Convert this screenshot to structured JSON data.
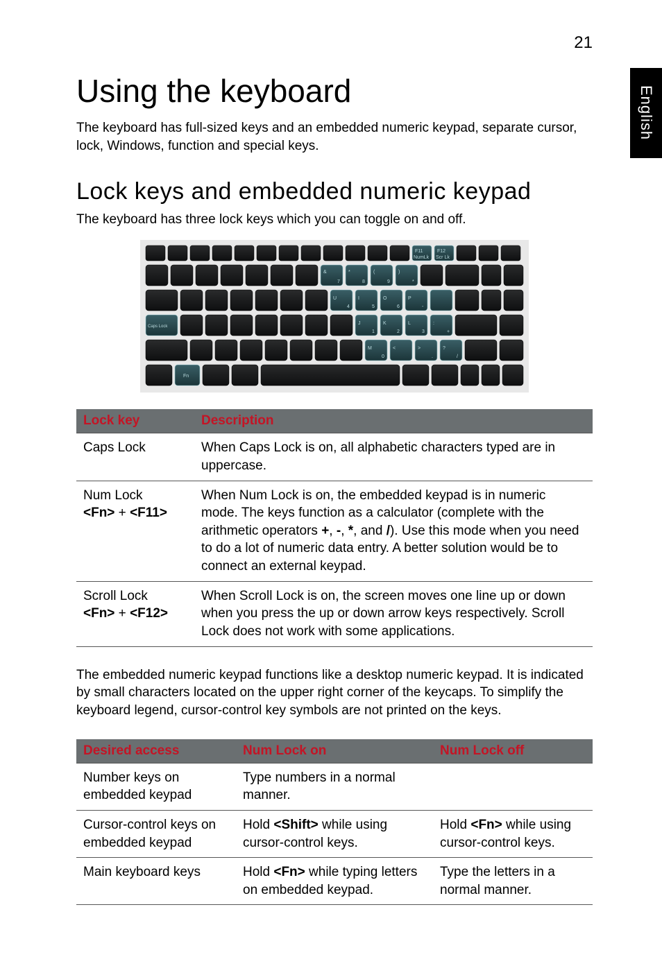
{
  "page_number": "21",
  "side_tab": "English",
  "h1": "Using the keyboard",
  "intro": "The keyboard has full-sized keys and an embedded numeric keypad, separate cursor, lock, Windows, function and special keys.",
  "h2": "Lock keys and embedded numeric keypad",
  "lead": "The keyboard has three lock keys which you can toggle on and off.",
  "table1": {
    "headers": [
      "Lock key",
      "Description"
    ],
    "rows": [
      {
        "key": "Caps Lock",
        "desc": "When Caps Lock is on, all alphabetic characters typed are in uppercase."
      },
      {
        "key_line1": "Num Lock",
        "key_line2_a": "<Fn>",
        "key_line2_plus": " + ",
        "key_line2_b": "<F11>",
        "desc_a": "When Num Lock is on, the embedded keypad is in numeric mode. The keys function as a calculator (complete with the arithmetic operators ",
        "desc_b": "+",
        "desc_c": ", ",
        "desc_d": "-",
        "desc_e": ", ",
        "desc_f": "*",
        "desc_g": ", and ",
        "desc_h": "/",
        "desc_i": "). Use this mode when you need to do a lot of numeric data entry. A better solution would be to connect an external keypad."
      },
      {
        "key_line1": "Scroll Lock",
        "key_line2_a": "<Fn>",
        "key_line2_plus": " + ",
        "key_line2_b": "<F12>",
        "desc": "When Scroll Lock is on, the screen moves one line up or down when you press the up or down arrow keys respectively. Scroll Lock does not work with some applications."
      }
    ]
  },
  "para2": "The embedded numeric keypad functions like a desktop numeric keypad. It is indicated by small characters located on the upper right corner of the keycaps. To simplify the keyboard legend, cursor-control key symbols are not printed on the keys.",
  "table2": {
    "headers": [
      "Desired access",
      "Num Lock on",
      "Num Lock off"
    ],
    "rows": [
      {
        "c1": "Number keys on embedded keypad",
        "c2": "Type numbers in a normal manner.",
        "c3": ""
      },
      {
        "c1": "Cursor-control keys on embedded keypad",
        "c2_a": "Hold ",
        "c2_b": "<Shift>",
        "c2_c": " while using cursor-control keys.",
        "c3_a": "Hold ",
        "c3_b": "<Fn>",
        "c3_c": " while using cursor-control keys."
      },
      {
        "c1": "Main keyboard keys",
        "c2_a": "Hold ",
        "c2_b": "<Fn>",
        "c2_c": " while typing letters on embedded keypad.",
        "c3": "Type the letters in a normal manner."
      }
    ]
  }
}
